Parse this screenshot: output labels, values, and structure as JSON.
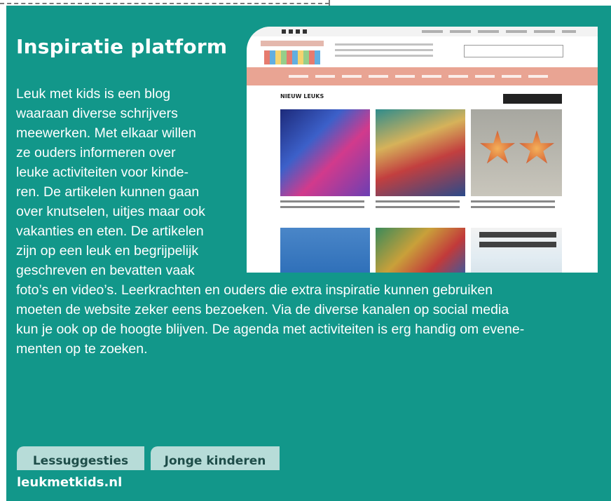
{
  "article": {
    "title": "Inspiratie platform",
    "body_lines": [
      "Leuk met kids is een blog",
      "waaraan diverse schrijvers",
      "meewerken. Met elkaar willen",
      "ze ouders informeren over",
      "leuke activiteiten voor kinde-",
      "ren. De artikelen kunnen gaan",
      "over knutselen, uitjes maar ook",
      "vakanties en eten. De artikelen",
      "zijn op een leuk en begrijpelijk",
      "geschreven en bevatten vaak",
      "foto’s en video’s. Leerkrachten en ouders die extra inspiratie kunnen gebruiken",
      "moeten de website zeker eens bezoeken. Via de diverse kanalen op social media",
      "kun je ook op de hoogte blijven. De agenda met activiteiten is erg handig om evene-",
      "menten op te zoeken."
    ],
    "tags": [
      "Lessuggesties",
      "Jonge kinderen"
    ],
    "url": "leukmetkids.nl"
  },
  "screenshot": {
    "section_heading": "NIEUW LEUKS"
  },
  "colors": {
    "card_background": "#12978a",
    "tag_background": "#b7dcd8",
    "tag_text": "#1e4d49",
    "nav_pink": "#e9a493"
  }
}
